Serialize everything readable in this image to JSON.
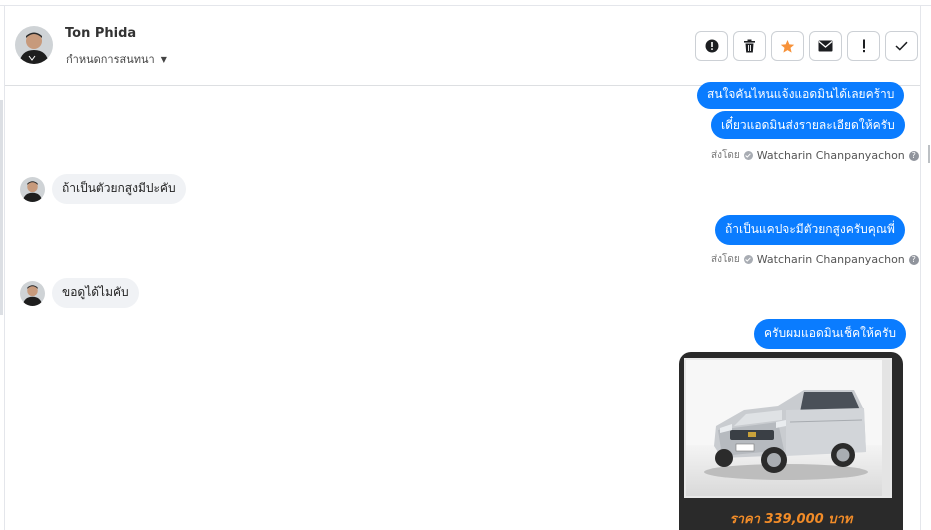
{
  "header": {
    "contact_name": "Ton Phida",
    "conversation_menu_label": "กำหนดการสนทนา",
    "actions": [
      {
        "name": "report-button",
        "icon": "alert-circle-icon"
      },
      {
        "name": "delete-button",
        "icon": "trash-icon"
      },
      {
        "name": "star-button",
        "icon": "star-icon",
        "color": "#f7923a"
      },
      {
        "name": "mark-unread-button",
        "icon": "envelope-icon"
      },
      {
        "name": "important-button",
        "icon": "exclamation-icon"
      },
      {
        "name": "done-button",
        "icon": "checkmark-icon"
      }
    ]
  },
  "messages": [
    {
      "direction": "outgoing",
      "text": "สนใจคันไหนแจ้งแอดมินได้เลยคร้าบ"
    },
    {
      "direction": "outgoing",
      "text": "เดี๋ยวแอดมินส่งรายละเอียดให้ครับ"
    },
    {
      "sent_by_label": "ส่งโดย",
      "sent_by_name": "Watcharin Chanpanyachon"
    },
    {
      "direction": "incoming",
      "text": "ถ้าเป็นตัวยกสูงมีปะคับ"
    },
    {
      "direction": "outgoing",
      "text": "ถ้าเป็นแคปจะมีตัวยกสูงครับคุณพี่"
    },
    {
      "sent_by_label": "ส่งโดย",
      "sent_by_name": "Watcharin Chanpanyachon"
    },
    {
      "direction": "incoming",
      "text": "ขอดูได้ไมคับ"
    },
    {
      "direction": "outgoing",
      "text": "ครับผมแอดมินเช็คให้ครับ"
    }
  ],
  "attachment": {
    "price_text": "ราคา 339,000 บาท",
    "price_color": "#f28c28"
  },
  "colors": {
    "outgoing_bubble": "#0a7cff",
    "incoming_bubble": "#f0f2f5"
  }
}
